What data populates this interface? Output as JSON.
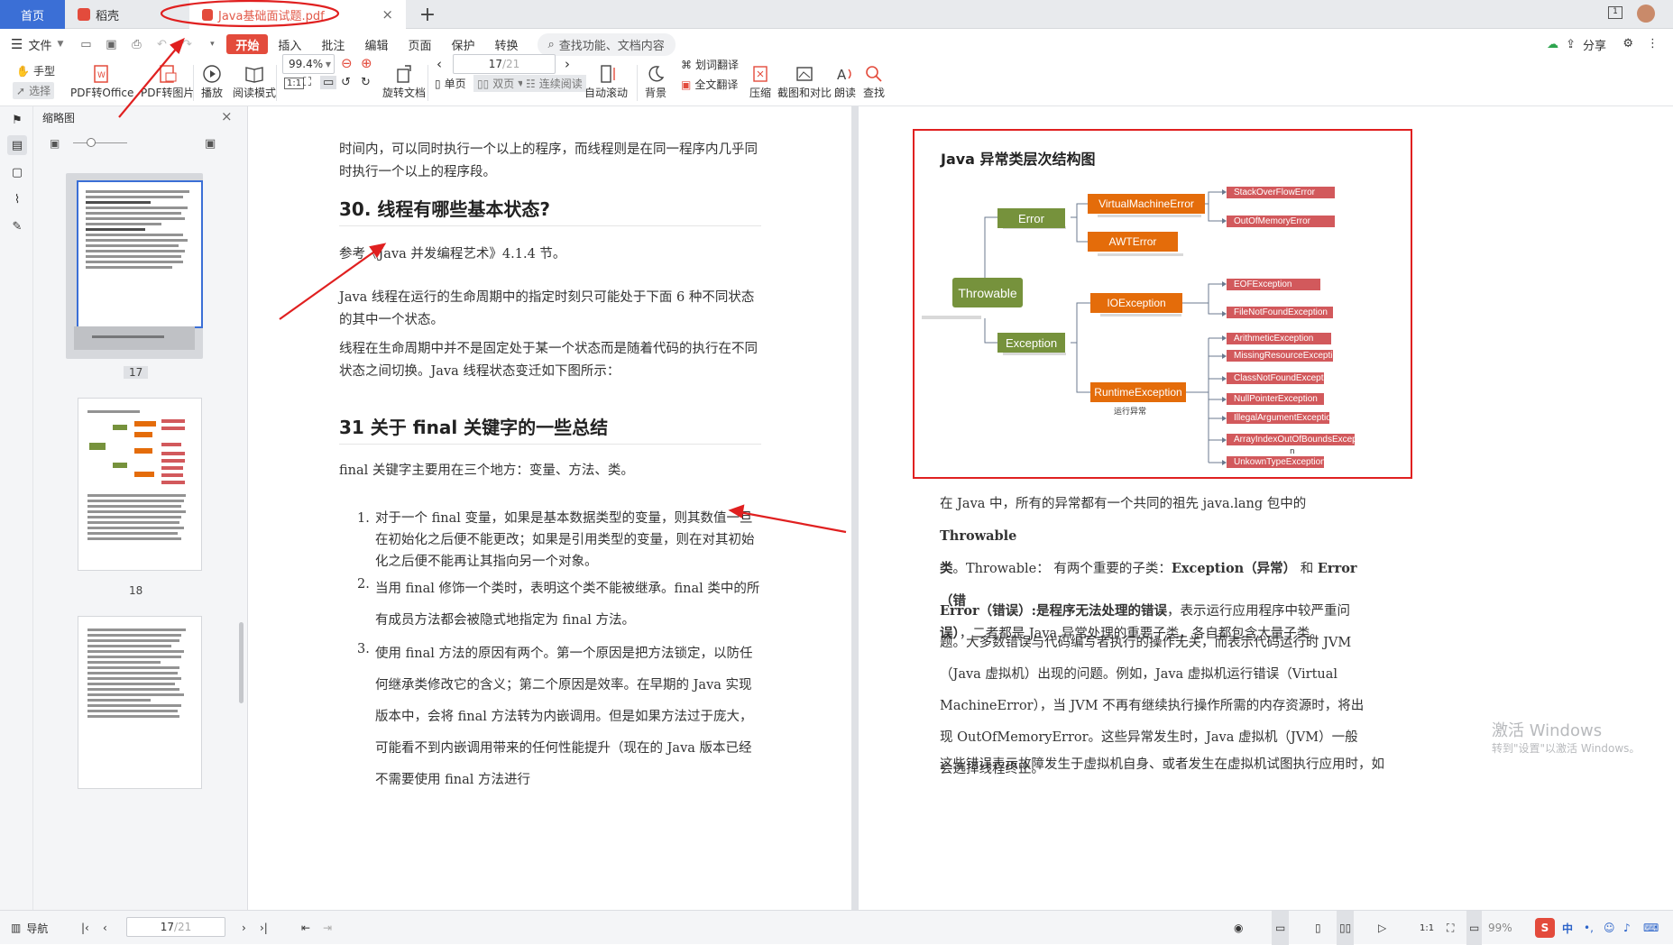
{
  "tabs": {
    "home": "首页",
    "docer": "稻壳",
    "pdf": "Java基础面试题.pdf",
    "close": "×",
    "new": "+"
  },
  "menu": {
    "file": "文件",
    "start": "开始",
    "insert": "插入",
    "annotate": "批注",
    "edit": "编辑",
    "page": "页面",
    "protect": "保护",
    "convert": "转换",
    "search_placeholder": "查找功能、文档内容",
    "share": "分享"
  },
  "toolbar": {
    "hand": "手型",
    "select": "选择",
    "pdf_to_office": "PDF转Office",
    "pdf_to_image": "PDF转图片",
    "play": "播放",
    "read_mode": "阅读模式",
    "zoom": "99.4%",
    "rotate": "旋转文档",
    "page_input": "17",
    "page_total": "/21",
    "single": "单页",
    "double": "双页",
    "continuous": "连续阅读",
    "auto_scroll": "自动滚动",
    "background": "背景",
    "word_translate": "划词翻译",
    "full_translate": "全文翻译",
    "compress": "压缩",
    "screenshot_compare": "截图和对比",
    "read_aloud": "朗读",
    "find": "查找"
  },
  "thumbnails": {
    "title": "缩略图",
    "pages": [
      "17",
      "18"
    ]
  },
  "page1": {
    "intro": "时间内，可以同时执行一个以上的程序，而线程则是在同一程序内几乎同时执行一个以上的程序段。",
    "h30": "30.  线程有哪些基本状态?",
    "p1": "参考《Java 并发编程艺术》4.1.4 节。",
    "p2": "Java 线程在运行的生命周期中的指定时刻只可能处于下面 6 种不同状态的其中一个状态。",
    "p3": "线程在生命周期中并不是固定处于某一个状态而是随着代码的执行在不同状态之间切换。Java 线程状态变迁如下图所示：",
    "h31": "31  关于 final 关键字的一些总结",
    "p4": "final 关键字主要用在三个地方：变量、方法、类。",
    "li1_num": "1.",
    "li1": "对于一个 final 变量，如果是基本数据类型的变量，则其数值一旦在初始化之后便不能更改；如果是引用类型的变量，则在对其初始化之后便不能再让其指向另一个对象。",
    "li2_num": "2.",
    "li2": "当用 final 修饰一个类时，表明这个类不能被继承。final 类中的所有成员方法都会被隐式地指定为 final 方法。",
    "li3_num": "3.",
    "li3": "使用 final 方法的原因有两个。第一个原因是把方法锁定，以防任何继承类修改它的含义；第二个原因是效率。在早期的 Java 实现版本中，会将 final 方法转为内嵌调用。但是如果方法过于庞大，可能看不到内嵌调用带来的任何性能提升（现在的 Java 版本已经不需要使用 final 方法进行"
  },
  "diagram": {
    "title": "Java 异常类层次结构图",
    "throwable": "Throwable",
    "error": "Error",
    "exception": "Exception",
    "vme": "VirtualMachineError",
    "awt": "AWTError",
    "io": "IOException",
    "runtime": "RuntimeException",
    "runtime_note": "运行异常",
    "so": "StackOverFlowError",
    "oom": "OutOfMemoryError",
    "eof": "EOFException",
    "fnf": "FileNotFoundException",
    "arith": "ArithmeticException",
    "missing": "MissingResourceException",
    "cnf": "ClassNotFoundException",
    "npe": "NullPointerException",
    "iae": "IllegalArgumentException",
    "aioobe": "ArrayIndexOutOfBoundsExceptio",
    "aioobe_tail": "n",
    "unknown": "UnkownTypeException"
  },
  "page2": {
    "p1a": "在  Java  中，所有的异常都有一个共同的祖先 java.lang 包中的 ",
    "p1b": "Throwable",
    "p1c": "类",
    "p1d": "。Throwable：  有两个重要的子类：",
    "p1e": "Exception（异常）",
    "p1f": " 和 ",
    "p1g": "Error（错",
    "p1h": "误）",
    "p1i": "，二者都是  Java  异常处理的重要子类，各自都包含大量子类。",
    "p2a": "Error（错误）:是程序无法处理的错误",
    "p2b": "，表示运行应用程序中较严重问题。大多数错误与代码编写者执行的操作无关，而表示代码运行时  JVM（Java  虚拟机）出现的问题。例如，Java 虚拟机运行错误（Virtual MachineError），当 JVM  不再有继续执行操作所需的内存资源时，将出现  OutOfMemoryError。这些异常发生时，Java 虚拟机（JVM）一般会选择线程终止。",
    "p2c": "这些错误表示故障发生于虚拟机自身、或者发生在虚拟机试图执行应用时，如",
    "watermark1": "激活 Windows",
    "watermark2": "转到\"设置\"以激活 Windows。"
  },
  "status": {
    "nav": "导航",
    "page_input": "17",
    "page_total": "/21",
    "zoom": "99%",
    "ime": "中"
  }
}
